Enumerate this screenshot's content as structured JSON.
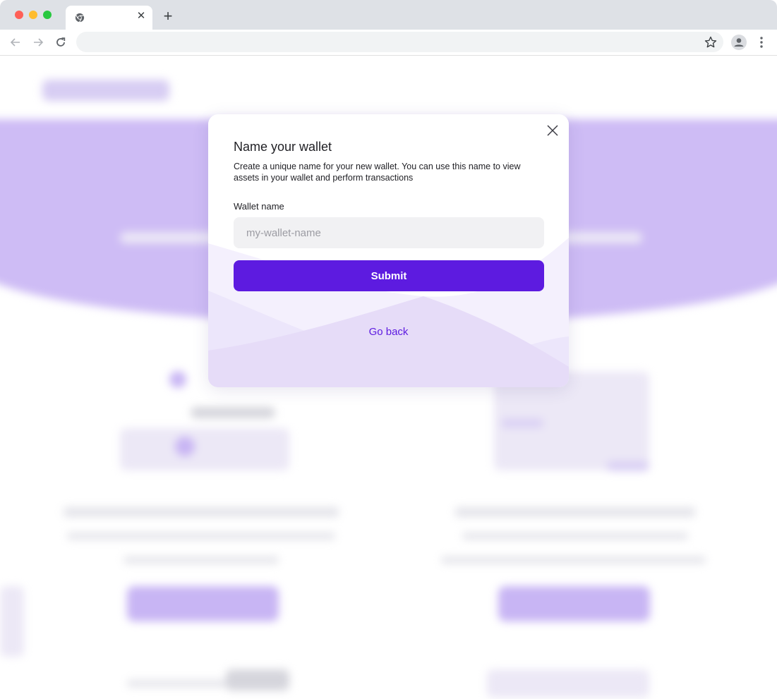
{
  "browser": {
    "tab_title": "",
    "address": "",
    "icons": {
      "back": "back-arrow-icon",
      "forward": "forward-arrow-icon",
      "reload": "reload-icon",
      "bookmark": "star-icon",
      "profile": "profile-icon",
      "menu": "kebab-menu-icon",
      "tab_close": "close-icon",
      "new_tab": "plus-icon"
    },
    "tab_close_glyph": "✕",
    "new_tab_glyph": "+"
  },
  "modal": {
    "title": "Name your wallet",
    "description": "Create a unique name for your new wallet. You can use this name to view assets in your wallet and perform transactions",
    "field_label": "Wallet name",
    "input_value": "",
    "input_placeholder": "my-wallet-name",
    "submit_label": "Submit",
    "go_back_label": "Go back"
  },
  "colors": {
    "accent": "#5d1be0",
    "hero_background": "#cebcf5",
    "input_background": "#f1f1f3"
  }
}
